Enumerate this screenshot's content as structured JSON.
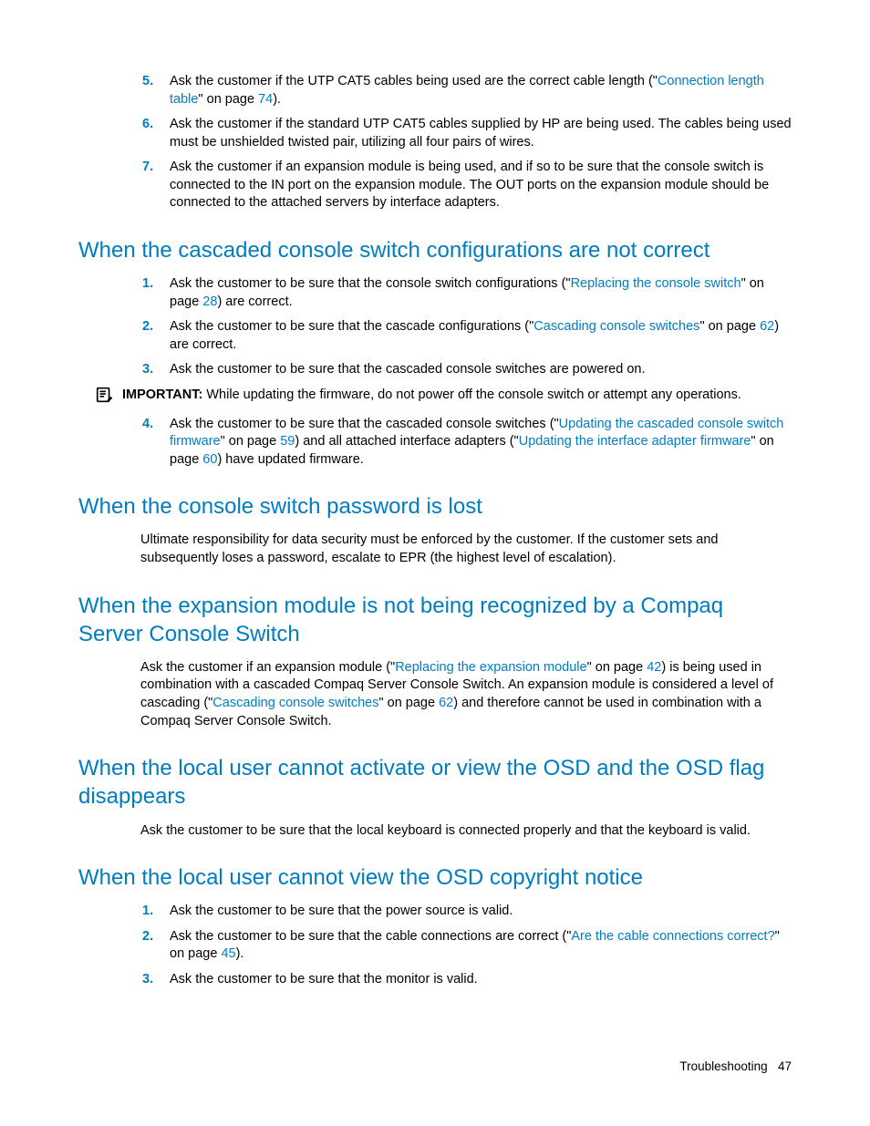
{
  "top_list": {
    "items": [
      {
        "num": "5.",
        "text_before": "Ask the customer if the UTP CAT5 cables being used are the correct cable length (\"",
        "link1": "Connection length table",
        "text_mid": "\" on page ",
        "link1_page": "74",
        "text_after": ")."
      },
      {
        "num": "6.",
        "text_before": "Ask the customer if the standard UTP CAT5 cables supplied by HP are being used. The cables being used must be unshielded twisted pair, utilizing all four pairs of wires."
      },
      {
        "num": "7.",
        "text_before": "Ask the customer if an expansion module is being used, and if so to be sure that the console switch is connected to the IN port on the expansion module. The OUT ports on the expansion module should be connected to the attached servers by interface adapters."
      }
    ]
  },
  "sections": {
    "cascaded": {
      "heading": "When the cascaded console switch configurations are not correct",
      "list1": [
        {
          "num": "1.",
          "text_before": "Ask the customer to be sure that the console switch configurations (\"",
          "link1": "Replacing the console switch",
          "text_mid": "\" on page ",
          "link1_page": "28",
          "text_after": ") are correct."
        },
        {
          "num": "2.",
          "text_before": "Ask the customer to be sure that the cascade configurations (\"",
          "link1": "Cascading console switches",
          "text_mid": "\" on page ",
          "link1_page": "62",
          "text_after": ") are correct."
        },
        {
          "num": "3.",
          "text_before": "Ask the customer to be sure that the cascaded console switches are powered on."
        }
      ],
      "important_label": "IMPORTANT:",
      "important_text": "  While updating the firmware, do not power off the console switch or attempt any operations.",
      "list2": [
        {
          "num": "4.",
          "text_before": "Ask the customer to be sure that the cascaded console switches (\"",
          "link1": "Updating the cascaded console switch firmware",
          "text_mid": "\" on page ",
          "link1_page": "59",
          "text_between": ") and all attached interface adapters (\"",
          "link2": "Updating the interface adapter firmware",
          "text_mid2": "\" on page ",
          "link2_page": "60",
          "text_after": ") have updated firmware."
        }
      ]
    },
    "password": {
      "heading": "When the console switch password is lost",
      "body": "Ultimate responsibility for data security must be enforced by the customer. If the customer sets and subsequently loses a password, escalate to EPR (the highest level of escalation)."
    },
    "expansion": {
      "heading": "When the expansion module is not being recognized by a Compaq Server Console Switch",
      "body_before": "Ask the customer if an expansion module (\"",
      "link1": "Replacing the expansion module",
      "body_mid1": "\" on page ",
      "link1_page": "42",
      "body_between": ") is being used in combination with a cascaded Compaq Server Console Switch. An expansion module is considered a level of cascading (\"",
      "link2": "Cascading console switches",
      "body_mid2": "\" on page ",
      "link2_page": "62",
      "body_after": ") and therefore cannot be used in combination with a Compaq Server Console Switch."
    },
    "osd_flag": {
      "heading": "When the local user cannot activate or view the OSD and the OSD flag disappears",
      "body": "Ask the customer to be sure that the local keyboard is connected properly and that the keyboard is valid."
    },
    "osd_copyright": {
      "heading": "When the local user cannot view the OSD copyright notice",
      "list": [
        {
          "num": "1.",
          "text_before": "Ask the customer to be sure that the power source is valid."
        },
        {
          "num": "2.",
          "text_before": "Ask the customer to be sure that the cable connections are correct (\"",
          "link1": "Are the cable connections correct?",
          "text_mid": "\" on page ",
          "link1_page": "45",
          "text_after": ")."
        },
        {
          "num": "3.",
          "text_before": "Ask the customer to be sure that the monitor is valid."
        }
      ]
    }
  },
  "footer": {
    "section_name": "Troubleshooting",
    "page_num": "47"
  }
}
